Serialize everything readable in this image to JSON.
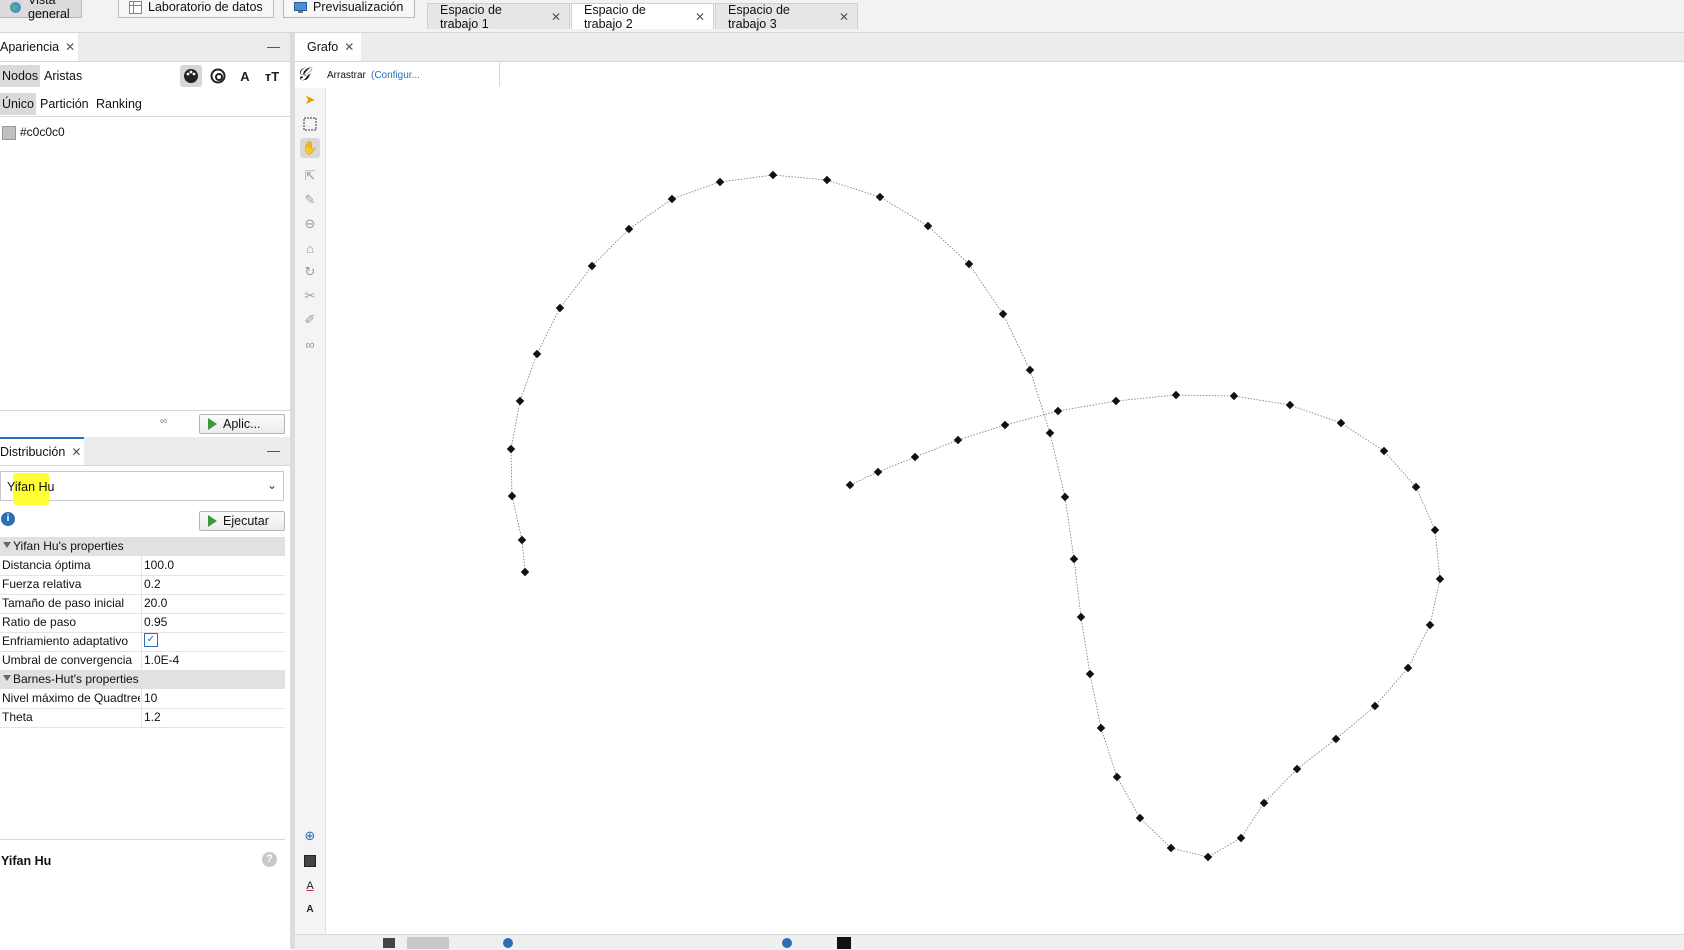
{
  "topbar": {
    "modes": [
      {
        "label": "Vista general"
      },
      {
        "label": "Laboratorio de datos"
      },
      {
        "label": "Previsualización"
      }
    ],
    "workspaces": [
      {
        "label": "Espacio de trabajo 1"
      },
      {
        "label": "Espacio de trabajo 2"
      },
      {
        "label": "Espacio de trabajo 3"
      }
    ],
    "active_workspace": 1
  },
  "appearance": {
    "tab_label": "Apariencia",
    "subtabs": [
      "Nodos",
      "Aristas"
    ],
    "modes": [
      "Único",
      "Partición",
      "Ranking"
    ],
    "color_value": "#c0c0c0",
    "apply_label": "Aplic..."
  },
  "layout_panel": {
    "tab_label": "Distribución",
    "selected_algorithm": "Yifan Hu",
    "run_label": "Ejecutar",
    "sections": [
      {
        "title": "Yifan Hu's properties",
        "rows": [
          {
            "key": "Distancia óptima",
            "value": "100.0"
          },
          {
            "key": "Fuerza relativa",
            "value": "0.2"
          },
          {
            "key": "Tamaño de paso inicial",
            "value": "20.0"
          },
          {
            "key": "Ratio de paso",
            "value": "0.95"
          },
          {
            "key": "Enfriamiento adaptativo",
            "value": "",
            "checkbox": true
          },
          {
            "key": "Umbral de convergencia",
            "value": "1.0E-4"
          }
        ]
      },
      {
        "title": "Barnes-Hut's properties",
        "rows": [
          {
            "key": "Nivel máximo de Quadtree",
            "value": "10"
          },
          {
            "key": "Theta",
            "value": "1.2"
          }
        ]
      }
    ],
    "description_title": "Yifan Hu"
  },
  "graph": {
    "tab_label": "Grafo",
    "drag_label": "Arrastrar",
    "config_label": "(Configur..."
  },
  "colors": {
    "node": "#111111",
    "edge": "#777777",
    "highlight": "#ffff33",
    "link": "#2a6fb8"
  }
}
